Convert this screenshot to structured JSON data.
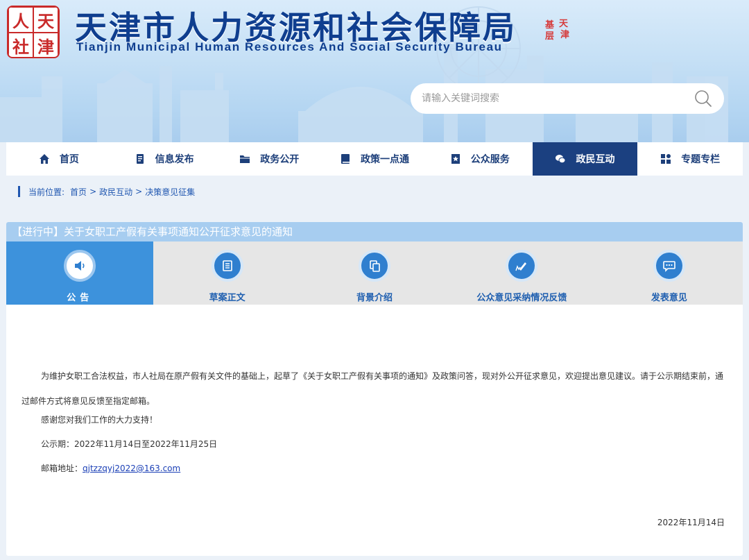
{
  "header": {
    "logo_chars": [
      "人",
      "天",
      "社",
      "津"
    ],
    "title": "天津市人力资源和社会保障局",
    "subtitle": "Tianjin Municipal Human Resources And Social Security Bureau",
    "seal_chars": [
      "基",
      "天",
      "层",
      "津"
    ],
    "search_placeholder": "请输入关键词搜索",
    "search_icon": "search-icon"
  },
  "nav": {
    "items": [
      {
        "label": "首页",
        "icon": "home-icon"
      },
      {
        "label": "信息发布",
        "icon": "document-icon"
      },
      {
        "label": "政务公开",
        "icon": "folder-icon"
      },
      {
        "label": "政策一点通",
        "icon": "book-icon"
      },
      {
        "label": "公众服务",
        "icon": "bookmark-icon"
      },
      {
        "label": "政民互动",
        "icon": "chat-icon"
      },
      {
        "label": "专题专栏",
        "icon": "grid-icon"
      }
    ],
    "active_index": 5
  },
  "breadcrumb": {
    "prefix": "当前位置:",
    "items": [
      "首页",
      "政民互动",
      "决策意见征集"
    ],
    "separator": ">"
  },
  "notice": {
    "title": "【进行中】关于女职工产假有关事项通知公开征求意见的通知"
  },
  "tabs": [
    {
      "label": "公告",
      "icon": "speaker-icon"
    },
    {
      "label": "草案正文",
      "icon": "list-doc-icon"
    },
    {
      "label": "背景介绍",
      "icon": "copy-icon"
    },
    {
      "label": "公众意见采纳情况反馈",
      "icon": "pen-icon"
    },
    {
      "label": "发表意见",
      "icon": "comment-icon"
    }
  ],
  "article": {
    "p1": "为维护女职工合法权益，市人社局在原产假有关文件的基础上，起草了《关于女职工产假有关事项的通知》及政策问答，现对外公开征求意见，欢迎提出意见建议。请于公示期结束前，通过邮件方式将意见反馈至指定邮箱。",
    "p2": "感谢您对我们工作的大力支持！",
    "p3": "公示期：2022年11月14日至2022年11月25日",
    "p4_label": "邮箱地址：",
    "email": "qjtzzqyj2022@163.com",
    "date": "2022年11月14日"
  },
  "colors": {
    "nav_active": "#1b4080",
    "tab_active": "#3d92dc",
    "title_bar": "#a7cdf0",
    "logo_red": "#c92a2a"
  }
}
